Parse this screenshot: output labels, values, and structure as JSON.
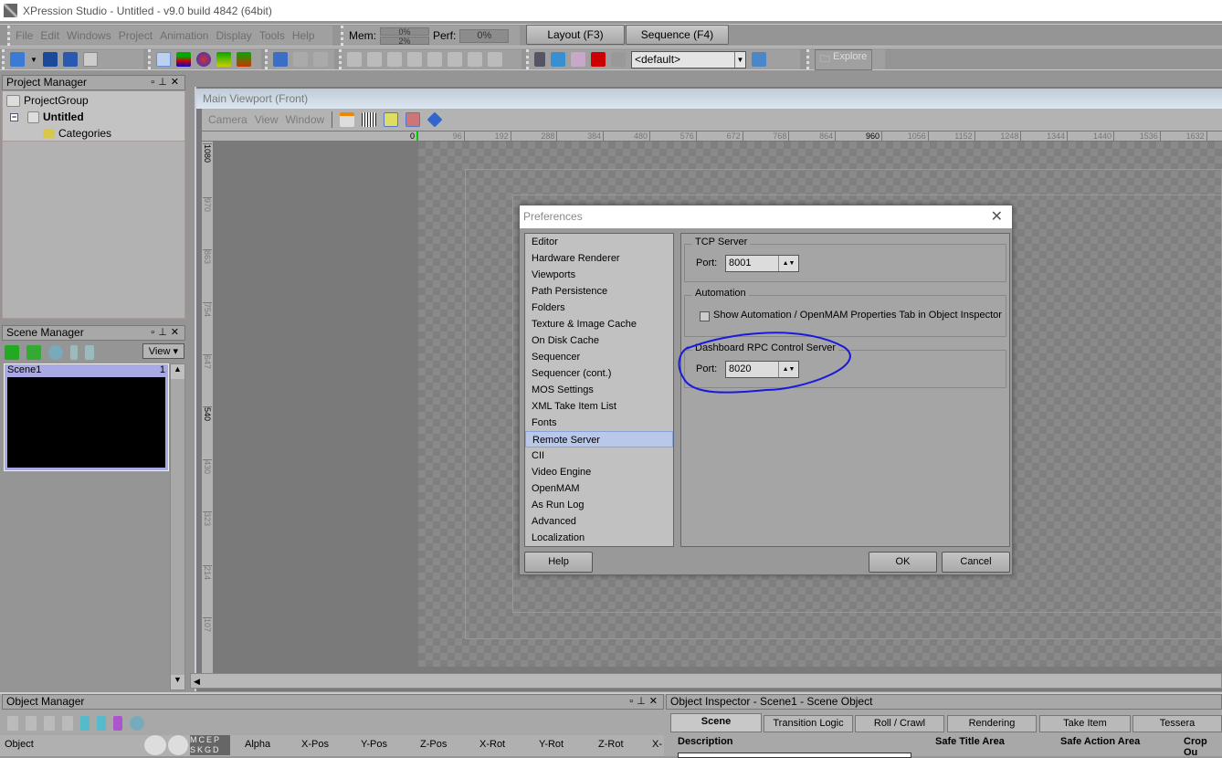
{
  "app": {
    "title": "XPression Studio - Untitled - v9.0 build 4842 (64bit)"
  },
  "menu": [
    "File",
    "Edit",
    "Windows",
    "Project",
    "Animation",
    "Display",
    "Tools",
    "Help"
  ],
  "status": {
    "mem_label": "Mem:",
    "mem_values": [
      "0%",
      "2%"
    ],
    "perf_label": "Perf:",
    "perf_value": "0%"
  },
  "modes": {
    "layout": "Layout (F3)",
    "sequence": "Sequence (F4)"
  },
  "toolbar": {
    "preset_value": "<default>",
    "explore": "Explore"
  },
  "project_manager": {
    "title": "Project Manager",
    "tree": [
      "ProjectGroup",
      "Untitled",
      "Categories"
    ]
  },
  "scene_manager": {
    "title": "Scene Manager",
    "view": "View",
    "scenes": [
      {
        "name": "Scene1",
        "number": "1"
      }
    ]
  },
  "viewport": {
    "title": "Main Viewport (Front)",
    "menu": [
      "Camera",
      "View",
      "Window"
    ],
    "hruler": [
      0,
      96,
      192,
      288,
      384,
      480,
      576,
      672,
      768,
      864,
      960,
      1056,
      1152,
      1248,
      1344,
      1440,
      1536,
      1632
    ],
    "vruler": [
      1080,
      970,
      863,
      754,
      647,
      540,
      430,
      323,
      214,
      107
    ]
  },
  "preferences": {
    "title": "Preferences",
    "categories": [
      "Editor",
      "Hardware Renderer",
      "Viewports",
      "Path Persistence",
      "Folders",
      "Texture & Image Cache",
      "On Disk Cache",
      "Sequencer",
      "Sequencer (cont.)",
      "MOS Settings",
      "XML Take Item List",
      "Fonts",
      "Remote Server",
      "CII",
      "Video Engine",
      "OpenMAM",
      "As Run Log",
      "Advanced",
      "Localization"
    ],
    "selected": "Remote Server",
    "tcp": {
      "legend": "TCP Server",
      "port_label": "Port:",
      "port": "8001"
    },
    "automation": {
      "legend": "Automation",
      "checkbox": "Show Automation / OpenMAM Properties Tab in Object Inspector",
      "checked": false
    },
    "rpc": {
      "legend": "Dashboard RPC Control Server",
      "port_label": "Port:",
      "port": "8020"
    },
    "help": "Help",
    "ok": "OK",
    "cancel": "Cancel"
  },
  "object_manager": {
    "title": "Object Manager",
    "flags": "MCEP SKGD",
    "columns": [
      "Object",
      "Alpha",
      "X-Pos",
      "Y-Pos",
      "Z-Pos",
      "X-Rot",
      "Y-Rot",
      "Z-Rot",
      "X-"
    ]
  },
  "object_inspector": {
    "title": "Object Inspector - Scene1 - Scene Object",
    "tabs": [
      "Scene",
      "Transition Logic",
      "Roll / Crawl",
      "Rendering",
      "Take Item",
      "Tessera"
    ],
    "sections": [
      "Description",
      "Safe Title Area",
      "Safe Action Area",
      "Crop Ou"
    ]
  },
  "colors": {
    "annotation": "#1a1adc",
    "selection": "#b9c8e8",
    "scene_selected": "#a9a9e3"
  }
}
